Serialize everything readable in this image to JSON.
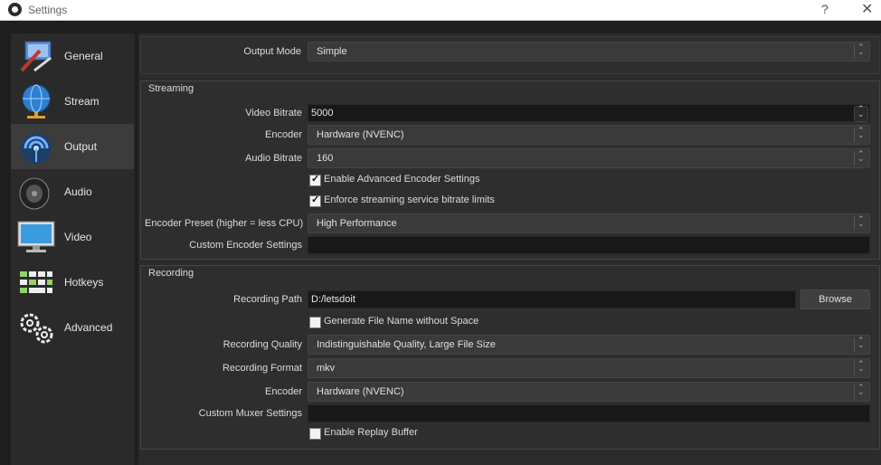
{
  "window": {
    "title": "Settings",
    "help": "?",
    "close": "✕"
  },
  "sidebar": {
    "items": [
      {
        "label": "General",
        "icon": "general-icon"
      },
      {
        "label": "Stream",
        "icon": "globe-icon"
      },
      {
        "label": "Output",
        "icon": "output-icon",
        "active": true
      },
      {
        "label": "Audio",
        "icon": "speaker-icon"
      },
      {
        "label": "Video",
        "icon": "monitor-icon"
      },
      {
        "label": "Hotkeys",
        "icon": "keyboard-icon"
      },
      {
        "label": "Advanced",
        "icon": "gears-icon"
      }
    ]
  },
  "output_mode": {
    "label": "Output Mode",
    "value": "Simple"
  },
  "streaming": {
    "title": "Streaming",
    "video_bitrate": {
      "label": "Video Bitrate",
      "value": "5000"
    },
    "encoder": {
      "label": "Encoder",
      "value": "Hardware (NVENC)"
    },
    "audio_bitrate": {
      "label": "Audio Bitrate",
      "value": "160"
    },
    "advanced_encoder": {
      "label": "Enable Advanced Encoder Settings",
      "checked": true
    },
    "enforce_limits": {
      "label": "Enforce streaming service bitrate limits",
      "checked": true
    },
    "preset": {
      "label": "Encoder Preset (higher = less CPU)",
      "value": "High Performance"
    },
    "custom_encoder": {
      "label": "Custom Encoder Settings",
      "value": ""
    }
  },
  "recording": {
    "title": "Recording",
    "path": {
      "label": "Recording Path",
      "value": "D:/letsdoit"
    },
    "browse_label": "Browse",
    "gen_filename": {
      "label": "Generate File Name without Space",
      "checked": false
    },
    "quality": {
      "label": "Recording Quality",
      "value": "Indistinguishable Quality, Large File Size"
    },
    "format": {
      "label": "Recording Format",
      "value": "mkv"
    },
    "encoder": {
      "label": "Encoder",
      "value": "Hardware (NVENC)"
    },
    "muxer": {
      "label": "Custom Muxer Settings",
      "value": ""
    },
    "replay_buffer": {
      "label": "Enable Replay Buffer",
      "checked": false
    }
  }
}
